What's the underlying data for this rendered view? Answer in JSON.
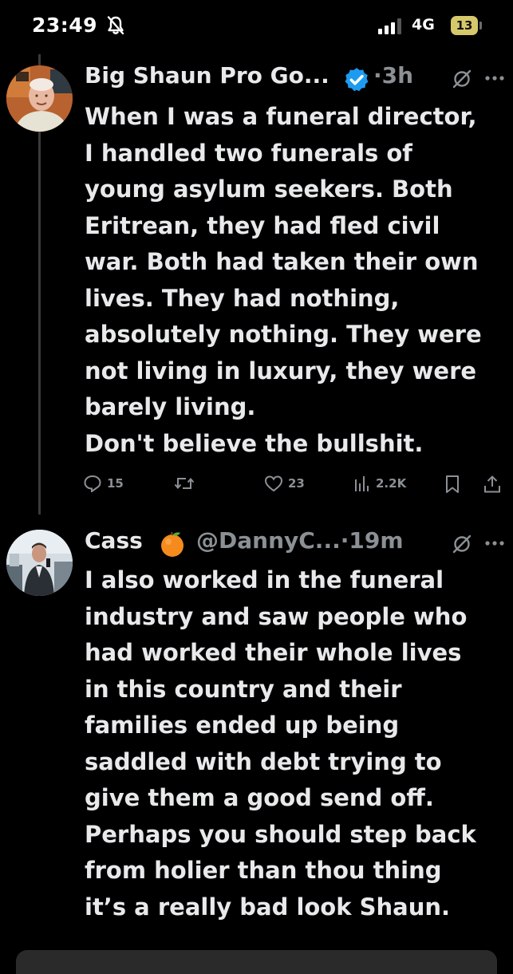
{
  "status_bar": {
    "time": "23:49",
    "network": "4G",
    "battery": "13",
    "icons": [
      "bell-muted-icon",
      "signal-icon"
    ]
  },
  "tweets": [
    {
      "name": "Big Shaun Pro Go...",
      "verified": true,
      "time": "·3h",
      "body_lines": [
        "When I was a funeral director,",
        "I handled two funerals of",
        "young asylum seekers. Both",
        "Eritrean, they had fled civil",
        "war. Both had taken their own",
        "lives. They had nothing,",
        "absolutely nothing. They were",
        "not living in luxury, they were",
        "barely living.",
        "Don't believe the bullshit."
      ],
      "actions": {
        "replies": "15",
        "likes": "23",
        "views": "2.2K"
      }
    },
    {
      "name": "Cass",
      "emoji": "🍊",
      "handle": "@DannyC...",
      "time": "·19m",
      "body_lines": [
        "I also worked in the funeral",
        "industry and saw people who",
        "had worked their whole lives",
        "in this country and their",
        "families ended up being",
        "saddled with debt trying to",
        "give them a good send off.",
        "Perhaps you should step back",
        "from holier than thou thing",
        "it’s a really bad look Shaun."
      ]
    }
  ],
  "colors": {
    "background": "#000000",
    "text": "#e7e9ea",
    "muted": "#8b9095",
    "verified": "#1d9bf0",
    "battery": "#d6c86a"
  }
}
